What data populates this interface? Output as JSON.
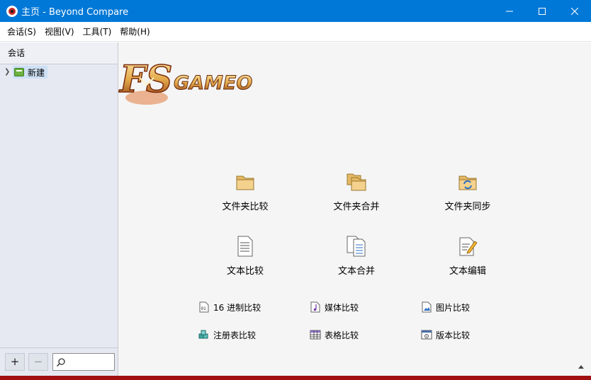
{
  "window": {
    "title": "主页 - Beyond Compare"
  },
  "menu": [
    "会话(S)",
    "视图(V)",
    "工具(T)",
    "帮助(H)"
  ],
  "sidebar": {
    "header": "会话",
    "items": [
      {
        "label": "新建"
      }
    ],
    "add_label": "+",
    "remove_label": "−"
  },
  "main": {
    "logo_text": "GAMEO",
    "big_tiles": [
      {
        "label": "文件夹比较",
        "icon": "folder-icon"
      },
      {
        "label": "文件夹合并",
        "icon": "folder-merge-icon"
      },
      {
        "label": "文件夹同步",
        "icon": "folder-sync-icon"
      },
      {
        "label": "文本比较",
        "icon": "text-compare-icon"
      },
      {
        "label": "文本合并",
        "icon": "text-merge-icon"
      },
      {
        "label": "文本编辑",
        "icon": "text-edit-icon"
      }
    ],
    "small_tiles": [
      {
        "label": "16 进制比较",
        "icon": "hex-compare-icon"
      },
      {
        "label": "媒体比较",
        "icon": "media-compare-icon"
      },
      {
        "label": "图片比较",
        "icon": "picture-compare-icon"
      },
      {
        "label": "注册表比较",
        "icon": "registry-compare-icon"
      },
      {
        "label": "表格比较",
        "icon": "table-compare-icon"
      },
      {
        "label": "版本比较",
        "icon": "version-compare-icon"
      }
    ]
  },
  "colors": {
    "titlebar": "#0078d7",
    "sidebar": "#e6e9f2",
    "main": "#f5f5f5",
    "accent_strip": "#a01010"
  }
}
